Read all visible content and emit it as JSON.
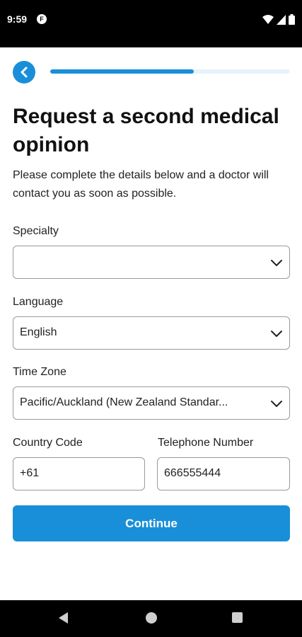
{
  "status_bar": {
    "time": "9:59",
    "app_icon_letter": "F"
  },
  "header": {
    "progress": 0.6
  },
  "title": "Request a second medical opinion",
  "subtitle": "Please complete the details below and a doctor will contact you as soon as possible.",
  "form": {
    "specialty": {
      "label": "Specialty",
      "value": ""
    },
    "language": {
      "label": "Language",
      "value": "English"
    },
    "time_zone": {
      "label": "Time Zone",
      "value": "Pacific/Auckland (New Zealand Standar..."
    },
    "country_code": {
      "label": "Country Code",
      "value": "+61"
    },
    "telephone": {
      "label": "Telephone Number",
      "value": "666555444"
    }
  },
  "continue_label": "Continue",
  "colors": {
    "accent": "#1a8fd9",
    "track": "#e7f3fb",
    "border": "#9a9a9a"
  },
  "icons": [
    "back-arrow-icon",
    "chevron-down-icon",
    "wifi-icon",
    "signal-icon",
    "battery-icon",
    "nav-back-icon",
    "nav-home-icon",
    "nav-recents-icon"
  ]
}
